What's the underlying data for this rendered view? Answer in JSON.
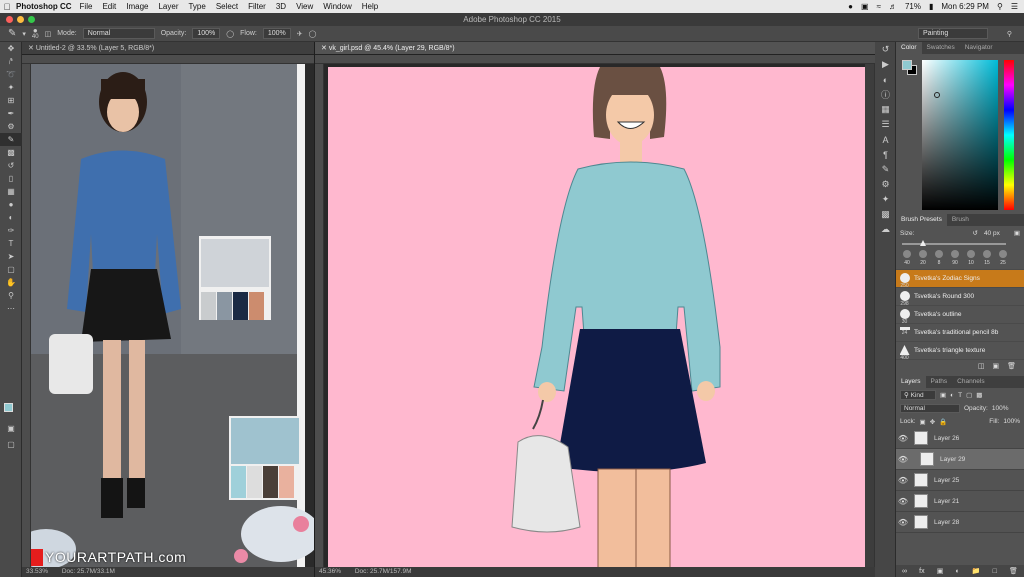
{
  "menubar": {
    "apple": "",
    "app": "Photoshop CC",
    "items": [
      "File",
      "Edit",
      "Image",
      "Layer",
      "Type",
      "Select",
      "Filter",
      "3D",
      "View",
      "Window",
      "Help"
    ],
    "battery": "71%",
    "clock": "Mon 6:29 PM"
  },
  "window_title": "Adobe Photoshop CC 2015",
  "options": {
    "brush_size": "40",
    "mode_label": "Mode:",
    "mode_value": "Normal",
    "opacity_label": "Opacity:",
    "opacity_value": "100%",
    "flow_label": "Flow:",
    "flow_value": "100%",
    "workspace": "Painting"
  },
  "doc_left": {
    "tab": "Untitled-2 @ 33.5% (Layer 5, RGB/8*)",
    "zoom": "33.53%",
    "doc_size": "Doc: 25.7M/33.1M"
  },
  "doc_main": {
    "tab": "vk_girl.psd @ 45.4% (Layer 29, RGB/8*)",
    "zoom": "45.36%",
    "doc_size": "Doc: 25.7M/157.9M"
  },
  "watermark": "YOURARTPATH.com",
  "color_panel": {
    "tabs": [
      "Color",
      "Swatches",
      "Navigator"
    ]
  },
  "brush_panel": {
    "tabs": [
      "Brush Presets",
      "Brush"
    ],
    "size_label": "Size:",
    "size_value": "40 px",
    "thumb_sizes": [
      "40",
      "20",
      "8",
      "90",
      "10",
      "15",
      "25"
    ],
    "items": [
      {
        "size": "250",
        "name": "Tsvetka's Zodiac Signs",
        "selected": true
      },
      {
        "size": "298",
        "name": "Tsvetka's Round 300",
        "selected": false
      },
      {
        "size": "30",
        "name": "Tsvetka's outline",
        "selected": false
      },
      {
        "size": "24",
        "name": "Tsvetka's traditional pencil 8b",
        "selected": false
      },
      {
        "size": "400",
        "name": "Tsvetka's triangle texture",
        "selected": false
      }
    ]
  },
  "layers_panel": {
    "tabs": [
      "Layers",
      "Paths",
      "Channels"
    ],
    "kind": "Kind",
    "blend": "Normal",
    "opacity_label": "Opacity:",
    "opacity_value": "100%",
    "lock_label": "Lock:",
    "fill_label": "Fill:",
    "fill_value": "100%",
    "layers": [
      {
        "name": "Layer 26",
        "selected": false
      },
      {
        "name": "Layer 29",
        "selected": true
      },
      {
        "name": "Layer 25",
        "selected": false
      },
      {
        "name": "Layer 21",
        "selected": false
      },
      {
        "name": "Layer 28",
        "selected": false
      }
    ]
  },
  "colors": {
    "accent": "#c77a1a",
    "canvas_pink": "#ffb8cf",
    "sweater": "#8fc9d0",
    "skirt": "#0f1b45"
  }
}
